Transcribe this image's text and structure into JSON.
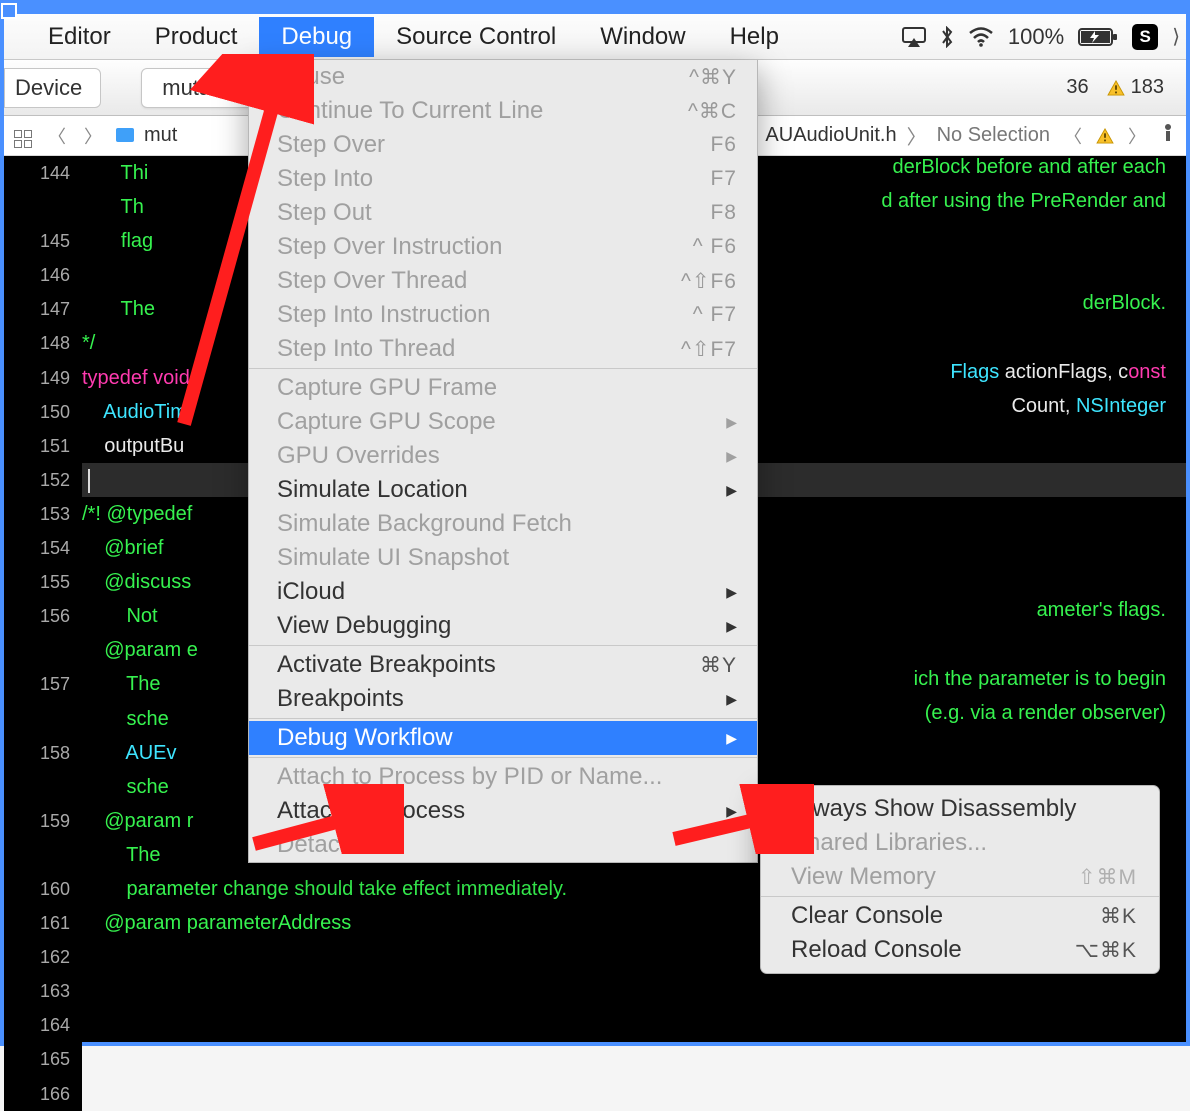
{
  "menubar": {
    "items": [
      "Editor",
      "Product",
      "Debug",
      "Source Control",
      "Window",
      "Help"
    ],
    "active_index": 2
  },
  "status": {
    "battery_pct": "100%"
  },
  "toolbar": {
    "device_label": "Device",
    "scheme_label": "mutation_w",
    "issue_count_left": "36",
    "issue_count_right": "183"
  },
  "jumpbar": {
    "file_short": "mut",
    "file_header": "AUAudioUnit.h",
    "selection": "No Selection"
  },
  "gutter_start": 144,
  "code_lines": [
    {
      "tokens": [
        {
          "t": "       Thi",
          "c": "tok-green"
        }
      ],
      "rfrag": {
        "t": "derBlock before and after each",
        "c": "tok-green"
      }
    },
    {
      "tokens": [
        {
          "t": "       Th",
          "c": "tok-green"
        }
      ],
      "rfrag": {
        "t": "d after using the PreRender and",
        "c": "tok-green"
      }
    },
    {
      "tokens": [
        {
          "t": "       flag",
          "c": "tok-green"
        }
      ]
    },
    {
      "tokens": []
    },
    {
      "tokens": [
        {
          "t": "       The",
          "c": "tok-green"
        }
      ],
      "rfrag": {
        "t": "derBlock.",
        "c": "tok-green"
      }
    },
    {
      "tokens": [
        {
          "t": "*/",
          "c": "tok-green"
        }
      ]
    },
    {
      "tokens": [
        {
          "t": "typedef ",
          "c": "tok-pink"
        },
        {
          "t": "void",
          "c": "tok-pink"
        }
      ],
      "rfrag": {
        "t": "Flags actionFlags, const",
        "c": "tok-white",
        "mix": [
          {
            "s": 0,
            "e": 5,
            "c": "tok-cyan"
          },
          {
            "s": 20,
            "e": 25,
            "c": "tok-pink"
          }
        ]
      }
    },
    {
      "tokens": [
        {
          "t": "    AudioTim",
          "c": "tok-cyan"
        }
      ],
      "rfrag": {
        "t": "Count, NSInteger",
        "c": "tok-white",
        "mix": [
          {
            "s": 7,
            "e": 16,
            "c": "tok-cyan"
          }
        ]
      }
    },
    {
      "tokens": [
        {
          "t": "    outputBu",
          "c": "tok-white"
        }
      ]
    },
    {
      "current": true,
      "tokens": [
        {
          "t": "",
          "c": "tok-white"
        }
      ]
    },
    {
      "tokens": [
        {
          "t": "/*! ",
          "c": "tok-green"
        },
        {
          "t": "@typedef",
          "c": "tok-green"
        }
      ]
    },
    {
      "tokens": [
        {
          "t": "    @brief",
          "c": "tok-green"
        }
      ]
    },
    {
      "tokens": [
        {
          "t": "    @discuss",
          "c": "tok-green"
        }
      ]
    },
    {
      "tokens": [
        {
          "t": "        Not",
          "c": "tok-green"
        }
      ],
      "rfrag": {
        "t": "ameter's flags.",
        "c": "tok-green"
      }
    },
    {
      "tokens": [
        {
          "t": "    @param e",
          "c": "tok-green"
        }
      ]
    },
    {
      "tokens": [
        {
          "t": "        The",
          "c": "tok-green"
        }
      ],
      "rfrag": {
        "t": "ich the parameter is to begin",
        "c": "tok-green"
      }
    },
    {
      "tokens": [
        {
          "t": "        sche",
          "c": "tok-green"
        }
      ],
      "rfrag": {
        "t": "(e.g. via a render observer)",
        "c": "tok-green"
      }
    },
    {
      "tokens": [
        {
          "t": "        AUEv",
          "c": "tok-cyan"
        }
      ]
    },
    {
      "tokens": [
        {
          "t": "        sche",
          "c": "tok-green"
        }
      ]
    },
    {
      "tokens": [
        {
          "t": "    @param r",
          "c": "tok-green"
        }
      ]
    },
    {
      "tokens": [
        {
          "t": "        The",
          "c": "tok-green"
        }
      ]
    },
    {
      "tokens": [
        {
          "t": "        parameter change should take effect immediately.",
          "c": "tok-green"
        }
      ]
    },
    {
      "tokens": [
        {
          "t": "    @param parameterAddress",
          "c": "tok-green"
        }
      ]
    }
  ],
  "debug_menu": [
    {
      "label": "Pause",
      "shortcut": "^⌘Y",
      "disabled": true
    },
    {
      "label": "Continue To Current Line",
      "shortcut": "^⌘C",
      "disabled": true
    },
    {
      "label": "Step Over",
      "shortcut": "F6",
      "disabled": true
    },
    {
      "label": "Step Into",
      "shortcut": "F7",
      "disabled": true
    },
    {
      "label": "Step Out",
      "shortcut": "F8",
      "disabled": true
    },
    {
      "label": "Step Over Instruction",
      "shortcut": "^ F6",
      "disabled": true
    },
    {
      "label": "Step Over Thread",
      "shortcut": "^⇧F6",
      "disabled": true
    },
    {
      "label": "Step Into Instruction",
      "shortcut": "^ F7",
      "disabled": true
    },
    {
      "label": "Step Into Thread",
      "shortcut": "^⇧F7",
      "disabled": true
    },
    {
      "sep": true
    },
    {
      "label": "Capture GPU Frame",
      "disabled": true
    },
    {
      "label": "Capture GPU Scope",
      "disabled": true,
      "submenu": true
    },
    {
      "label": "GPU Overrides",
      "disabled": true,
      "submenu": true
    },
    {
      "label": "Simulate Location",
      "submenu": true
    },
    {
      "label": "Simulate Background Fetch",
      "disabled": true
    },
    {
      "label": "Simulate UI Snapshot",
      "disabled": true
    },
    {
      "label": "iCloud",
      "submenu": true
    },
    {
      "label": "View Debugging",
      "submenu": true
    },
    {
      "sep": true
    },
    {
      "label": "Activate Breakpoints",
      "shortcut": "⌘Y"
    },
    {
      "label": "Breakpoints",
      "submenu": true
    },
    {
      "sep": true
    },
    {
      "label": "Debug Workflow",
      "submenu": true,
      "highlight": true
    },
    {
      "sep": true
    },
    {
      "label": "Attach to Process by PID or Name...",
      "disabled": true
    },
    {
      "label": "Attach to Process",
      "submenu": true
    },
    {
      "label": "Detach",
      "disabled": true
    }
  ],
  "workflow_submenu": [
    {
      "label": "Always Show Disassembly"
    },
    {
      "label": "Shared Libraries...",
      "disabled": true
    },
    {
      "label": "View Memory",
      "shortcut": "⇧⌘M",
      "disabled": true
    },
    {
      "sep": true
    },
    {
      "label": "Clear Console",
      "shortcut": "⌘K"
    },
    {
      "label": "Reload Console",
      "shortcut": "⌥⌘K"
    }
  ]
}
